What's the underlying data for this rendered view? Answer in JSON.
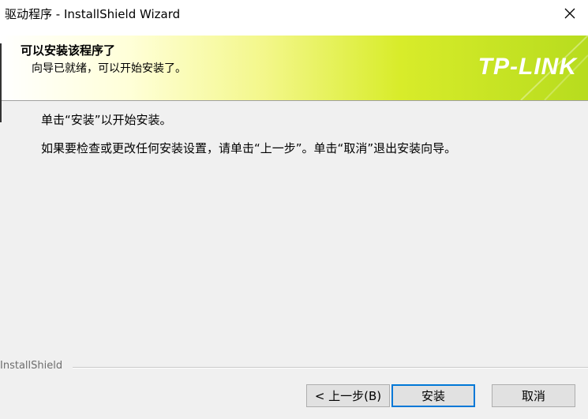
{
  "window": {
    "title": "驱动程序 - InstallShield Wizard",
    "close_glyph": "✕"
  },
  "banner": {
    "title": "可以安装该程序了",
    "subtitle": "向导已就绪，可以开始安装了。",
    "logo_text": "TP-LINK"
  },
  "content": {
    "line1": "单击“安装”以开始安装。",
    "line2": "如果要检查或更改任何安装设置，请单击“上一步”。单击“取消”退出安装向导。"
  },
  "footer": {
    "brand": "InstallShield",
    "back_label": "< 上一步(B)",
    "install_label": "安装",
    "cancel_label": "取消"
  },
  "colors": {
    "accent_border": "#0078d7",
    "banner_gradient_end": "#b7dc1e"
  }
}
